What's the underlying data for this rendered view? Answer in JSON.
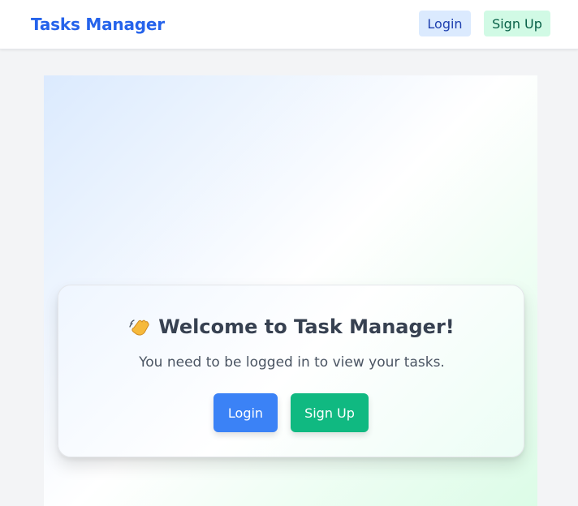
{
  "navbar": {
    "brand": "Tasks Manager",
    "login_label": "Login",
    "signup_label": "Sign Up"
  },
  "welcome": {
    "icon": "waving-hand-icon",
    "title": "Welcome to Task Manager!",
    "message": "You need to be logged in to view your tasks.",
    "login_label": "Login",
    "signup_label": "Sign Up"
  },
  "colors": {
    "brand": "#2563eb",
    "primary_button": "#3b82f6",
    "success_button": "#10b981",
    "nav_login_bg": "#dbeafe",
    "nav_signup_bg": "#d1fae5"
  }
}
